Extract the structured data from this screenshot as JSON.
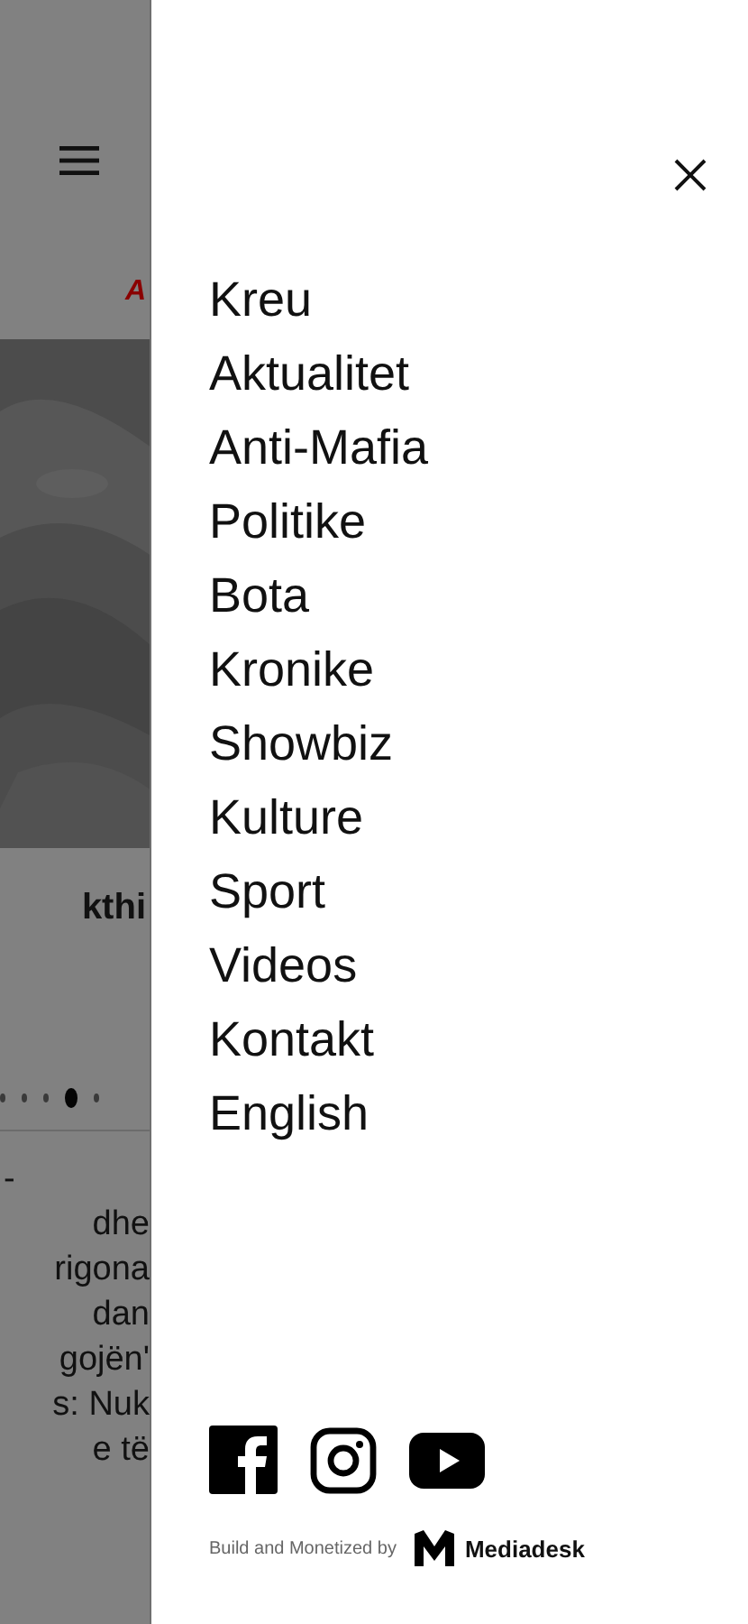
{
  "background": {
    "tab_fragment": "A",
    "headline_fragment": "kthi",
    "slider_dots": [
      {
        "selected": false
      },
      {
        "selected": false
      },
      {
        "selected": false
      },
      {
        "selected": true
      },
      {
        "selected": false
      }
    ],
    "article_lines": [
      "-",
      "dhe",
      "rigona",
      "dan",
      "gojën'",
      "s: Nuk",
      "e të"
    ]
  },
  "menu": {
    "items": [
      "Kreu",
      "Aktualitet",
      "Anti-Mafia",
      "Politike",
      "Bota",
      "Kronike",
      "Showbiz",
      "Kulture",
      "Sport",
      "Videos",
      "Kontakt",
      "English"
    ]
  },
  "footer": {
    "social": [
      {
        "kind": "facebook"
      },
      {
        "kind": "instagram"
      },
      {
        "kind": "youtube"
      }
    ],
    "credit": "Build and Monetized by",
    "brand": "Mediadesk"
  }
}
